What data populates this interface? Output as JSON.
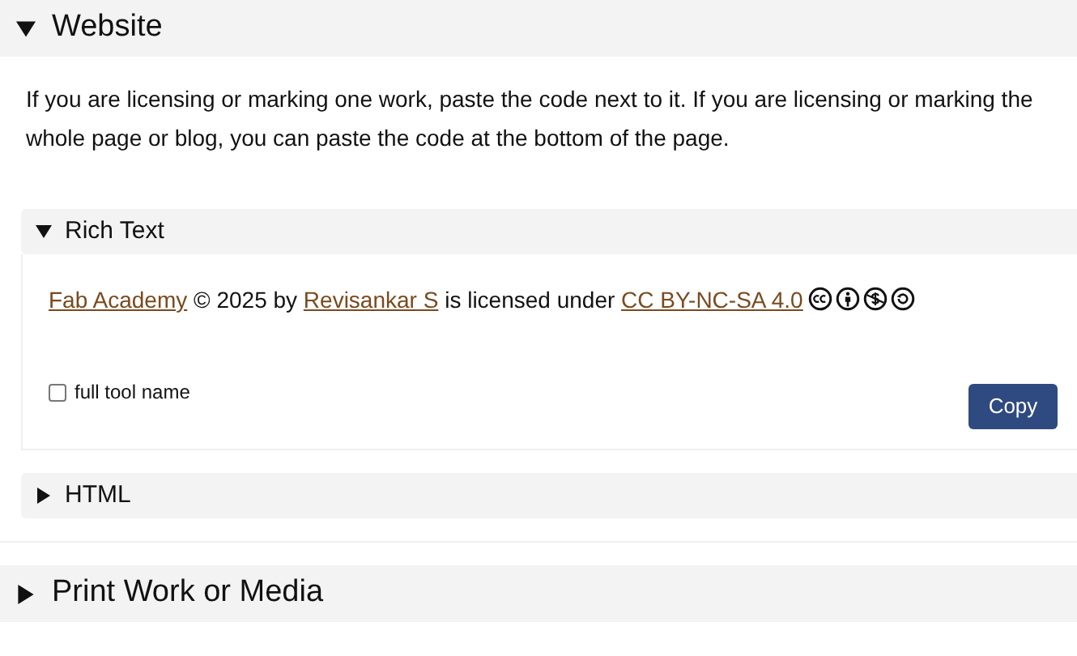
{
  "sections": [
    {
      "title": "Website",
      "expanded": true,
      "description": "If you are licensing or marking one work, paste the code next to it. If you are licensing or marking the whole page or blog, you can paste the code at the bottom of the page.",
      "subsections": [
        {
          "title": "Rich Text",
          "expanded": true,
          "attribution": [
            {
              "kind": "link",
              "text": "Fab Academy"
            },
            {
              "kind": "text",
              "text": "© 2025 by"
            },
            {
              "kind": "link",
              "text": "Revisankar S"
            },
            {
              "kind": "text",
              "text": "is licensed under"
            },
            {
              "kind": "link",
              "text": "CC BY-NC-SA 4.0"
            }
          ],
          "option": {
            "label": "full tool name",
            "checked": false
          },
          "button": "Copy"
        },
        {
          "title": "HTML",
          "expanded": false
        }
      ]
    },
    {
      "title": "Print Work or Media",
      "expanded": false
    }
  ]
}
